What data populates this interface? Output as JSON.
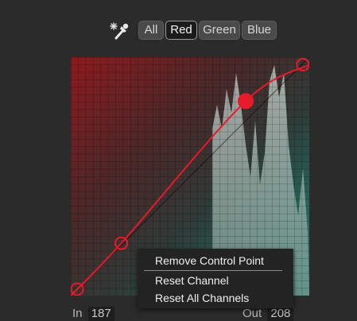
{
  "toolbar": {
    "eyedropper_icon": "eyedropper-sparkle-icon",
    "tabs": [
      {
        "label": "All",
        "active": false
      },
      {
        "label": "Red",
        "active": true
      },
      {
        "label": "Green",
        "active": false
      },
      {
        "label": "Blue",
        "active": false
      }
    ]
  },
  "curve": {
    "channel_color": "#e8192a",
    "control_points": [
      {
        "in": 0,
        "out": 0
      },
      {
        "in": 54,
        "out": 56
      },
      {
        "in": 187,
        "out": 208
      },
      {
        "in": 255,
        "out": 247
      }
    ],
    "selected_point_index": 2
  },
  "readout": {
    "in_label": "In",
    "in_value": "187",
    "out_label": "Out",
    "out_value": "208"
  },
  "context_menu": {
    "items": [
      {
        "label": "Remove Control Point"
      },
      {
        "label": "Reset Channel"
      },
      {
        "label": "Reset All Channels"
      }
    ]
  }
}
